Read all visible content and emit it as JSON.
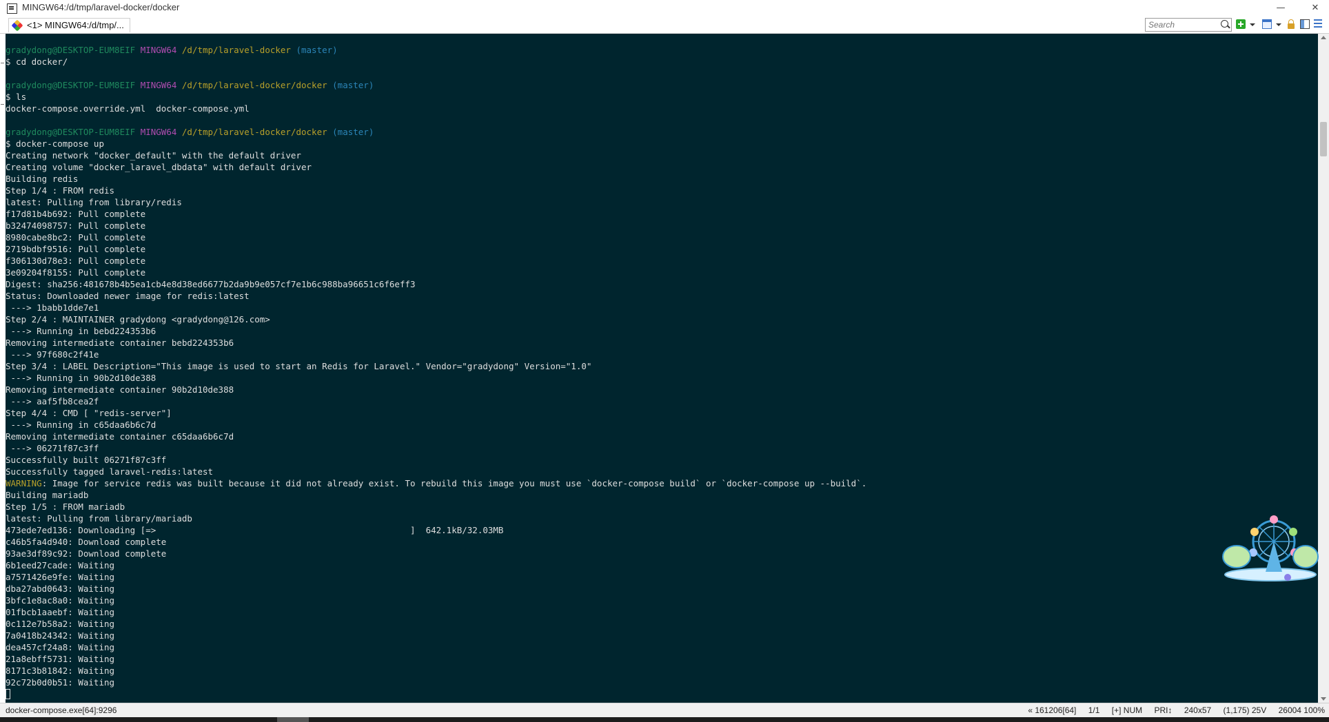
{
  "window": {
    "title": "MINGW64:/d/tmp/laravel-docker/docker",
    "minimize": "—",
    "restore": "❐",
    "close": "✕"
  },
  "toolbar": {
    "tab_label": "<1> MINGW64:/d/tmp/...",
    "search_placeholder": "Search"
  },
  "colors": {
    "console_bg": "#00252e",
    "console_fg": "#dedede",
    "prompt_user": "#1f8a5e",
    "prompt_host": "#b04cb0",
    "prompt_path": "#b8a02a",
    "prompt_branch": "#2b85b8",
    "warning": "#b8a02a"
  },
  "icons": [
    "app-icon",
    "tab-icon",
    "search-icon",
    "add-console-icon",
    "window-icon",
    "lock-icon",
    "pane-icon",
    "menu-icon",
    "mascot-ferris-wheel-icon"
  ],
  "terminal": {
    "lines": [
      {
        "type": "prompt",
        "user": "gradydong@DESKTOP-EUM8EIF",
        "host": "MINGW64",
        "path": "/d/tmp/laravel-docker",
        "branch": "(master)"
      },
      {
        "type": "text",
        "text": "$ cd docker/"
      },
      {
        "type": "blank",
        "text": ""
      },
      {
        "type": "prompt",
        "user": "gradydong@DESKTOP-EUM8EIF",
        "host": "MINGW64",
        "path": "/d/tmp/laravel-docker/docker",
        "branch": "(master)"
      },
      {
        "type": "text",
        "text": "$ ls"
      },
      {
        "type": "text",
        "text": "docker-compose.override.yml  docker-compose.yml"
      },
      {
        "type": "blank",
        "text": ""
      },
      {
        "type": "prompt",
        "user": "gradydong@DESKTOP-EUM8EIF",
        "host": "MINGW64",
        "path": "/d/tmp/laravel-docker/docker",
        "branch": "(master)"
      },
      {
        "type": "text",
        "text": "$ docker-compose up"
      },
      {
        "type": "text",
        "text": "Creating network \"docker_default\" with the default driver"
      },
      {
        "type": "text",
        "text": "Creating volume \"docker_laravel_dbdata\" with default driver"
      },
      {
        "type": "text",
        "text": "Building redis"
      },
      {
        "type": "text",
        "text": "Step 1/4 : FROM redis"
      },
      {
        "type": "text",
        "text": "latest: Pulling from library/redis"
      },
      {
        "type": "text",
        "text": "f17d81b4b692: Pull complete"
      },
      {
        "type": "text",
        "text": "b32474098757: Pull complete"
      },
      {
        "type": "text",
        "text": "8980cabe8bc2: Pull complete"
      },
      {
        "type": "text",
        "text": "2719bdbf9516: Pull complete"
      },
      {
        "type": "text",
        "text": "f306130d78e3: Pull complete"
      },
      {
        "type": "text",
        "text": "3e09204f8155: Pull complete"
      },
      {
        "type": "text",
        "text": "Digest: sha256:481678b4b5ea1cb4e8d38ed6677b2da9b9e057cf7e1b6c988ba96651c6f6eff3"
      },
      {
        "type": "text",
        "text": "Status: Downloaded newer image for redis:latest"
      },
      {
        "type": "text",
        "text": " ---> 1babb1dde7e1"
      },
      {
        "type": "text",
        "text": "Step 2/4 : MAINTAINER gradydong <gradydong@126.com>"
      },
      {
        "type": "text",
        "text": " ---> Running in bebd224353b6"
      },
      {
        "type": "text",
        "text": "Removing intermediate container bebd224353b6"
      },
      {
        "type": "text",
        "text": " ---> 97f680c2f41e"
      },
      {
        "type": "text",
        "text": "Step 3/4 : LABEL Description=\"This image is used to start an Redis for Laravel.\" Vendor=\"gradydong\" Version=\"1.0\""
      },
      {
        "type": "text",
        "text": " ---> Running in 90b2d10de388"
      },
      {
        "type": "text",
        "text": "Removing intermediate container 90b2d10de388"
      },
      {
        "type": "text",
        "text": " ---> aaf5fb8cea2f"
      },
      {
        "type": "text",
        "text": "Step 4/4 : CMD [ \"redis-server\"]"
      },
      {
        "type": "text",
        "text": " ---> Running in c65daa6b6c7d"
      },
      {
        "type": "text",
        "text": "Removing intermediate container c65daa6b6c7d"
      },
      {
        "type": "text",
        "text": " ---> 06271f87c3ff"
      },
      {
        "type": "text",
        "text": "Successfully built 06271f87c3ff"
      },
      {
        "type": "text",
        "text": "Successfully tagged laravel-redis:latest"
      },
      {
        "type": "warning",
        "label": "WARNING",
        "text": ": Image for service redis was built because it did not already exist. To rebuild this image you must use `docker-compose build` or `docker-compose up --build`."
      },
      {
        "type": "text",
        "text": "Building mariadb"
      },
      {
        "type": "text",
        "text": "Step 1/5 : FROM mariadb"
      },
      {
        "type": "text",
        "text": "latest: Pulling from library/mariadb"
      },
      {
        "type": "text",
        "text": "473ede7ed136: Downloading [=>                                                 ]  642.1kB/32.03MB"
      },
      {
        "type": "text",
        "text": "c46b5fa4d940: Download complete"
      },
      {
        "type": "text",
        "text": "93ae3df89c92: Download complete"
      },
      {
        "type": "text",
        "text": "6b1eed27cade: Waiting"
      },
      {
        "type": "text",
        "text": "a7571426e9fe: Waiting"
      },
      {
        "type": "text",
        "text": "dba27abd0643: Waiting"
      },
      {
        "type": "text",
        "text": "3bfc1e8ac8a0: Waiting"
      },
      {
        "type": "text",
        "text": "01fbcb1aaebf: Waiting"
      },
      {
        "type": "text",
        "text": "0c112e7b58a2: Waiting"
      },
      {
        "type": "text",
        "text": "7a0418b24342: Waiting"
      },
      {
        "type": "text",
        "text": "dea457cf24a8: Waiting"
      },
      {
        "type": "text",
        "text": "21a8ebff5731: Waiting"
      },
      {
        "type": "text",
        "text": "8171c3b81842: Waiting"
      },
      {
        "type": "text",
        "text": "92c72b0d0b51: Waiting"
      },
      {
        "type": "cursor",
        "text": ""
      }
    ]
  },
  "statusbar": {
    "process": "docker-compose.exe[64]:9296",
    "pos": "« 161206[64]",
    "page": "1/1",
    "flags": "[+] NUM",
    "priority": "PRI↕",
    "size": "240x57",
    "cursor": "(1,175) 25V",
    "buffer": "26004 100%"
  }
}
